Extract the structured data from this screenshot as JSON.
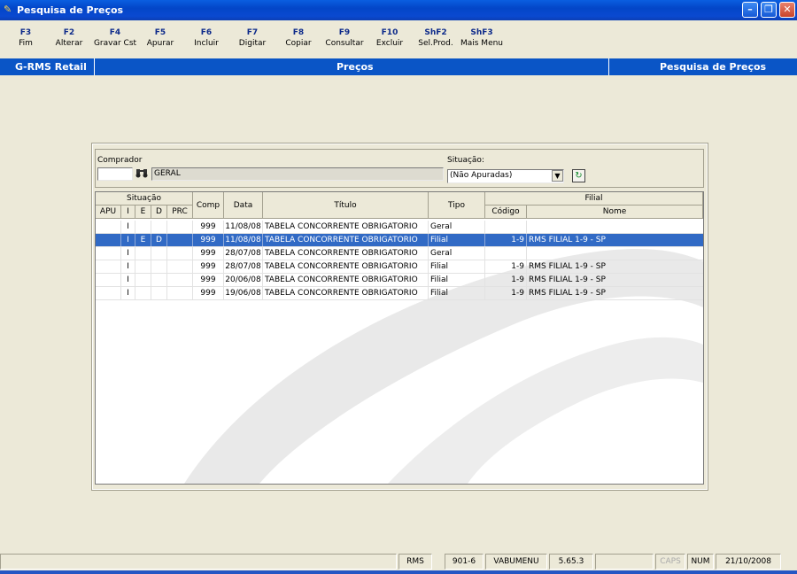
{
  "window": {
    "title": "Pesquisa de Preços",
    "controls": [
      "minimize",
      "restore",
      "close"
    ]
  },
  "toolbar": [
    {
      "key": "F3",
      "label": "Fim"
    },
    {
      "key": "F2",
      "label": "Alterar"
    },
    {
      "key": "F4",
      "label": "Gravar Cst"
    },
    {
      "key": "F5",
      "label": "Apurar"
    },
    {
      "key": "F6",
      "label": "Incluir"
    },
    {
      "key": "F7",
      "label": "Digitar"
    },
    {
      "key": "F8",
      "label": "Copiar"
    },
    {
      "key": "F9",
      "label": "Consultar"
    },
    {
      "key": "F10",
      "label": "Excluir"
    },
    {
      "key": "ShF2",
      "label": "Sel.Prod."
    },
    {
      "key": "ShF3",
      "label": "Mais Menu"
    }
  ],
  "header": {
    "left": "G-RMS Retail",
    "center": "Preços",
    "right": "Pesquisa de Preços"
  },
  "filters": {
    "comprador_label": "Comprador",
    "comprador_code": "",
    "comprador_name": "GERAL",
    "situacao_label": "Situação:",
    "situacao_value": "(Não Apuradas)"
  },
  "grid": {
    "group_headers": {
      "situacao": "Situação",
      "filial": "Filial"
    },
    "columns": {
      "apu": "APU",
      "i": "I",
      "e": "E",
      "d": "D",
      "prc": "PRC",
      "comp": "Comp",
      "data": "Data",
      "titulo": "Título",
      "tipo": "Tipo",
      "codigo": "Código",
      "nome": "Nome"
    },
    "rows": [
      {
        "apu": "",
        "i": "I",
        "e": "",
        "d": "",
        "prc": "",
        "comp": "999",
        "data": "11/08/08",
        "titulo": "TABELA CONCORRENTE OBRIGATORIO",
        "tipo": "Geral",
        "codigo": "",
        "nome": "",
        "selected": false
      },
      {
        "apu": "",
        "i": "I",
        "e": "E",
        "d": "D",
        "prc": "",
        "comp": "999",
        "data": "11/08/08",
        "titulo": "TABELA CONCORRENTE OBRIGATORIO",
        "tipo": "Filial",
        "codigo": "1-9",
        "nome": "RMS FILIAL 1-9 - SP",
        "selected": true
      },
      {
        "apu": "",
        "i": "I",
        "e": "",
        "d": "",
        "prc": "",
        "comp": "999",
        "data": "28/07/08",
        "titulo": "TABELA CONCORRENTE OBRIGATORIO",
        "tipo": "Geral",
        "codigo": "",
        "nome": "",
        "selected": false
      },
      {
        "apu": "",
        "i": "I",
        "e": "",
        "d": "",
        "prc": "",
        "comp": "999",
        "data": "28/07/08",
        "titulo": "TABELA CONCORRENTE OBRIGATORIO",
        "tipo": "Filial",
        "codigo": "1-9",
        "nome": "RMS FILIAL 1-9 - SP",
        "selected": false
      },
      {
        "apu": "",
        "i": "I",
        "e": "",
        "d": "",
        "prc": "",
        "comp": "999",
        "data": "20/06/08",
        "titulo": "TABELA CONCORRENTE OBRIGATORIO",
        "tipo": "Filial",
        "codigo": "1-9",
        "nome": "RMS FILIAL 1-9 - SP",
        "selected": false
      },
      {
        "apu": "",
        "i": "I",
        "e": "",
        "d": "",
        "prc": "",
        "comp": "999",
        "data": "19/06/08",
        "titulo": "TABELA CONCORRENTE OBRIGATORIO",
        "tipo": "Filial",
        "codigo": "1-9",
        "nome": "RMS FILIAL 1-9 - SP",
        "selected": false
      }
    ]
  },
  "statusbar": {
    "system": "RMS",
    "code": "901-6",
    "menu": "VABUMENU",
    "version": "5.65.3",
    "caps": "CAPS",
    "num": "NUM",
    "date": "21/10/2008"
  }
}
